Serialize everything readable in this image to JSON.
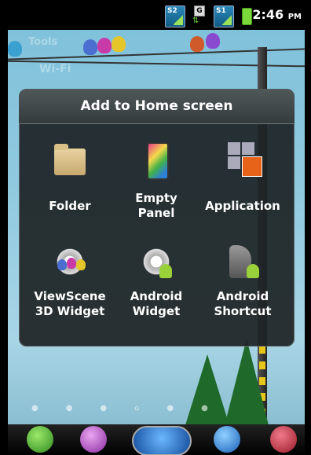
{
  "status_bar": {
    "sim1_label": "S2",
    "network_label": "G",
    "sim2_label": "S1",
    "time": "2:46",
    "ampm": "PM",
    "icons": [
      "signal-icon",
      "data-icon",
      "signal-icon",
      "battery-icon"
    ]
  },
  "home_background": {
    "tools_label": "Tools",
    "wifi_label": "Wi-Fi"
  },
  "dialog": {
    "title": "Add to Home screen",
    "options": [
      {
        "label_line1": "Folder",
        "label_line2": "",
        "icon": "folder-icon"
      },
      {
        "label_line1": "Empty",
        "label_line2": "Panel",
        "icon": "empty-panel-icon"
      },
      {
        "label_line1": "Application",
        "label_line2": "",
        "icon": "application-icon"
      },
      {
        "label_line1": "ViewScene",
        "label_line2": "3D Widget",
        "icon": "viewscene-icon"
      },
      {
        "label_line1": "Android",
        "label_line2": "Widget",
        "icon": "android-widget-icon"
      },
      {
        "label_line1": "Android",
        "label_line2": "Shortcut",
        "icon": "android-shortcut-icon"
      }
    ]
  },
  "dock": {
    "items": [
      "phone-icon",
      "messaging-icon",
      "home-birds-icon",
      "browser-icon",
      "apps-icon"
    ]
  },
  "colors": {
    "dialog_bg": "#1e2426",
    "battery": "#7bd83a",
    "accent_orange": "#e8631a"
  }
}
